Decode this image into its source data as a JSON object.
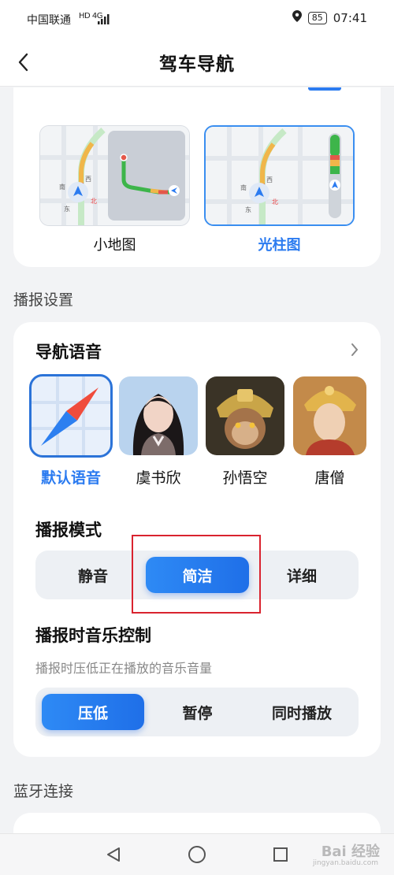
{
  "status": {
    "carrier": "中国联通",
    "network": "HD 4G",
    "battery": "85",
    "time": "07:41"
  },
  "header": {
    "title": "驾车导航"
  },
  "map_style": {
    "options": [
      {
        "label": "小地图",
        "selected": false
      },
      {
        "label": "光柱图",
        "selected": true
      }
    ],
    "accent_color": "#2b7bf0"
  },
  "broadcast": {
    "section_label": "播报设置",
    "voice": {
      "title": "导航语音",
      "items": [
        {
          "label": "默认语音",
          "selected": true,
          "icon": "compass-icon"
        },
        {
          "label": "虞书欣",
          "selected": false,
          "icon": "avatar-portrait"
        },
        {
          "label": "孙悟空",
          "selected": false,
          "icon": "avatar-monkey-king"
        },
        {
          "label": "唐僧",
          "selected": false,
          "icon": "avatar-monk"
        }
      ]
    },
    "mode": {
      "title": "播报模式",
      "options": [
        "静音",
        "简洁",
        "详细"
      ],
      "selected": "简洁"
    },
    "music": {
      "title": "播报时音乐控制",
      "description": "播报时压低正在播放的音乐音量",
      "options": [
        "压低",
        "暂停",
        "同时播放"
      ],
      "selected": "压低"
    }
  },
  "bluetooth": {
    "section_label": "蓝牙连接"
  },
  "watermark": {
    "text": "Bai 经验",
    "sub": "jingyan.baidu.com"
  }
}
